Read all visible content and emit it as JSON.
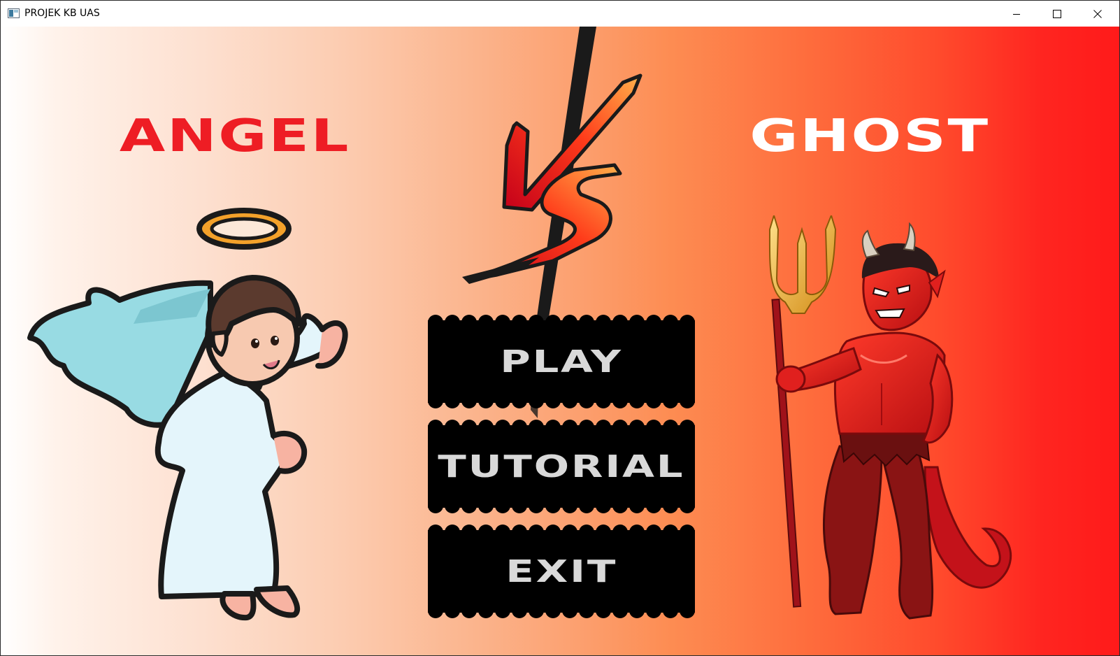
{
  "window": {
    "title": "PROJEK KB UAS",
    "controls": {
      "minimize": "minimize-icon",
      "maximize": "maximize-icon",
      "close": "close-icon"
    }
  },
  "scene": {
    "left_character": "ANGEL",
    "right_character": "GHOST",
    "versus_logo": "VS",
    "menu": {
      "play": "PLAY",
      "tutorial": "TUTORIAL",
      "exit": "EXIT"
    }
  },
  "colors": {
    "angel_label": "#ee1d24",
    "ghost_label": "#ffffff",
    "gradient_left": "#ffffff",
    "gradient_right": "#ff1a1a",
    "button_bg": "#000000",
    "button_text": "#d9d9d9"
  }
}
